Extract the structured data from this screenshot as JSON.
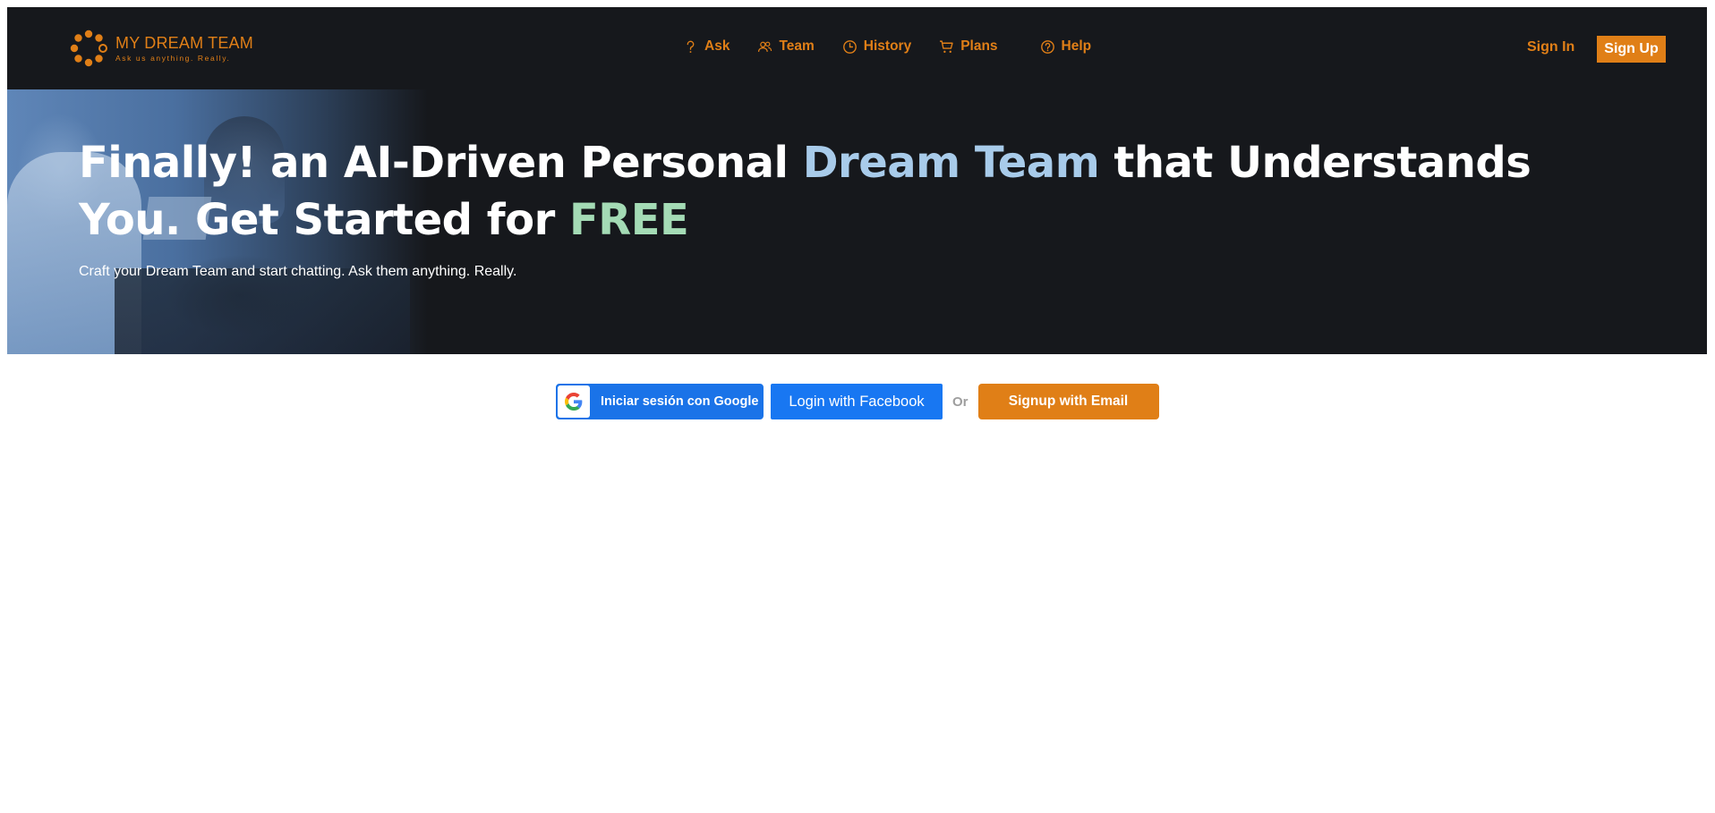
{
  "brand": {
    "name": "MY DREAM TEAM",
    "tagline": "Ask us anything. Really.",
    "accent_color": "#e07f17"
  },
  "nav": {
    "items": [
      {
        "label": "Ask",
        "icon": "question-icon"
      },
      {
        "label": "Team",
        "icon": "users-icon"
      },
      {
        "label": "History",
        "icon": "clock-icon"
      },
      {
        "label": "Plans",
        "icon": "cart-icon"
      },
      {
        "label": "Help",
        "icon": "help-circle-icon"
      }
    ],
    "sign_in": "Sign In",
    "sign_up": "Sign Up"
  },
  "hero": {
    "title_part1": "Finally! an AI-Driven Personal ",
    "title_highlight1": "Dream Team",
    "title_part2": " that Understands You. Get Started for ",
    "title_highlight2": "FREE",
    "subtitle": "Craft your Dream Team and start chatting. Ask them anything. Really.",
    "highlight1_color": "#a8cbea",
    "highlight2_color": "#a4dbb5"
  },
  "auth": {
    "google_label": "Iniciar sesión con Google",
    "facebook_label": "Login with Facebook",
    "or_label": "Or",
    "email_label": "Signup with Email"
  }
}
